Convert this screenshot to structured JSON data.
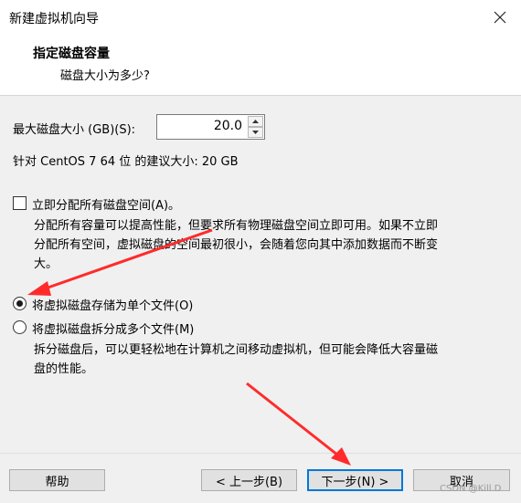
{
  "window": {
    "title": "新建虚拟机向导"
  },
  "header": {
    "title": "指定磁盘容量",
    "subtitle": "磁盘大小为多少?"
  },
  "disk_size": {
    "label": "最大磁盘大小 (GB)(S):",
    "value": "20.0"
  },
  "recommended": {
    "text": "针对 CentOS 7 64 位 的建议大小: 20 GB"
  },
  "allocate": {
    "checkbox_label": "立即分配所有磁盘空间(A)。",
    "checked": false,
    "description_line1": "分配所有容量可以提高性能，但要求所有物理磁盘空间立即可用。如果不立即",
    "description_line2": "分配所有空间，虚拟磁盘的空间最初很小，会随着您向其中添加数据而不断变",
    "description_line3": "大。"
  },
  "storage_options": [
    {
      "label": "将虚拟磁盘存储为单个文件(O)",
      "selected": true
    },
    {
      "label": "将虚拟磁盘拆分成多个文件(M)",
      "selected": false
    }
  ],
  "split_description": {
    "line1": "拆分磁盘后，可以更轻松地在计算机之间移动虚拟机，但可能会降低大容量磁",
    "line2": "盘的性能。"
  },
  "buttons": {
    "help": "帮助",
    "back": "< 上一步(B)",
    "next": "下一步(N) >",
    "cancel": "取消"
  },
  "watermark": "CSDN @Kill.D",
  "colors": {
    "annotation_arrow": "#ff2b2b",
    "focus_border": "#0078d7"
  },
  "icons": {
    "close": "close-icon"
  }
}
